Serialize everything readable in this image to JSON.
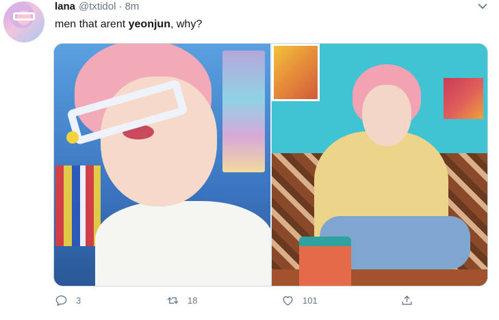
{
  "tweet": {
    "author_name": "lana",
    "handle": "@txtidol",
    "separator": "·",
    "time": "8m",
    "text_before": "men that arent ",
    "text_bold": "yeonjun",
    "text_after": ", why?"
  },
  "actions": {
    "reply_count": "3",
    "retweet_count": "18",
    "like_count": "101"
  },
  "icons": {
    "reply": "reply-icon",
    "retweet": "retweet-icon",
    "like": "heart-icon",
    "share": "share-icon",
    "more": "chevron-down-icon"
  },
  "colors": {
    "muted": "#657786",
    "text": "#14171a",
    "border": "#ccd6dd"
  }
}
